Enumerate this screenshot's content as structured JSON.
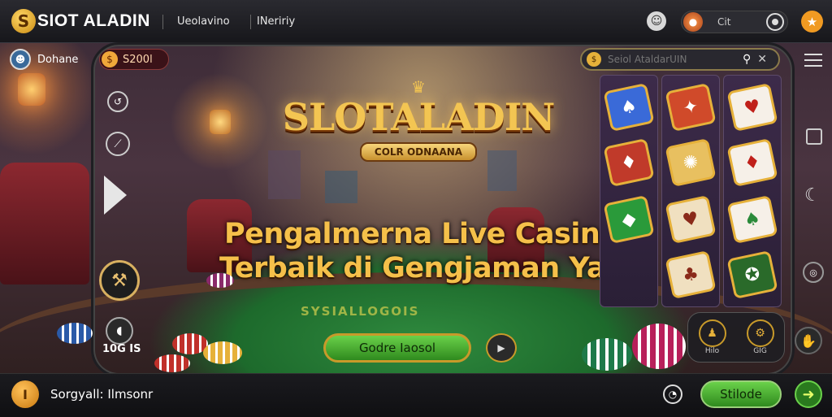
{
  "header": {
    "logo_letter": "S",
    "brand": "SIOT ALADIN",
    "nav": [
      "Ueolavino",
      "INeririy"
    ],
    "right_text": "Cit"
  },
  "left_rail": {
    "user_name": "Dohane",
    "balance": "S200l",
    "counter": "10G IS"
  },
  "search": {
    "placeholder": "Seiol AtaldarUIN"
  },
  "hero": {
    "logo_title": "SLOTALADIN",
    "logo_subtitle": "COLR ODNAANA",
    "headline_line1": "Pengalmerna Live Casino",
    "headline_line2": "Terbaik di Gengjaman Yada",
    "felt_text": "SYSIALLOGOIS",
    "cta_label": "Godre Iaosol"
  },
  "side_tools": [
    "Hilo",
    "GIG"
  ],
  "bottom": {
    "logo_letter": "I",
    "message": "Sorgyall: Ilmsonr",
    "action_label": "Stilode"
  },
  "colors": {
    "accent_gold": "#f3c552",
    "accent_green": "#4cb82e",
    "panel_bg": "#2a1f36"
  }
}
